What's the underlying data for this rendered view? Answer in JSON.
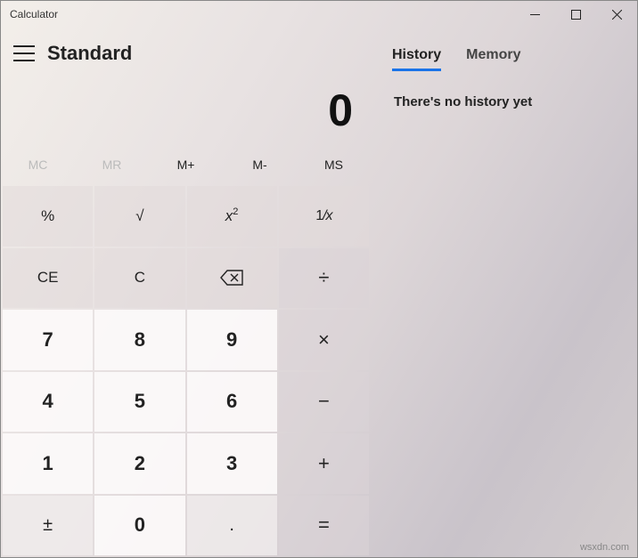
{
  "window": {
    "title": "Calculator"
  },
  "header": {
    "mode": "Standard"
  },
  "display": {
    "value": "0"
  },
  "memory_buttons": {
    "mc": "MC",
    "mr": "MR",
    "mplus": "M+",
    "mminus": "M-",
    "ms": "MS"
  },
  "keys": {
    "percent": "%",
    "sqrt": "√",
    "square_base": "x",
    "square_exp": "2",
    "recip_num": "1",
    "recip_slash": "/",
    "recip_den": "x",
    "ce": "CE",
    "c": "C",
    "divide": "÷",
    "n7": "7",
    "n8": "8",
    "n9": "9",
    "multiply": "×",
    "n4": "4",
    "n5": "5",
    "n6": "6",
    "minus": "−",
    "n1": "1",
    "n2": "2",
    "n3": "3",
    "plus": "+",
    "negate": "±",
    "n0": "0",
    "decimal": ".",
    "equals": "="
  },
  "tabs": {
    "history": "History",
    "memory": "Memory"
  },
  "panel": {
    "empty_history": "There's no history yet"
  },
  "watermark": "wsxdn.com"
}
